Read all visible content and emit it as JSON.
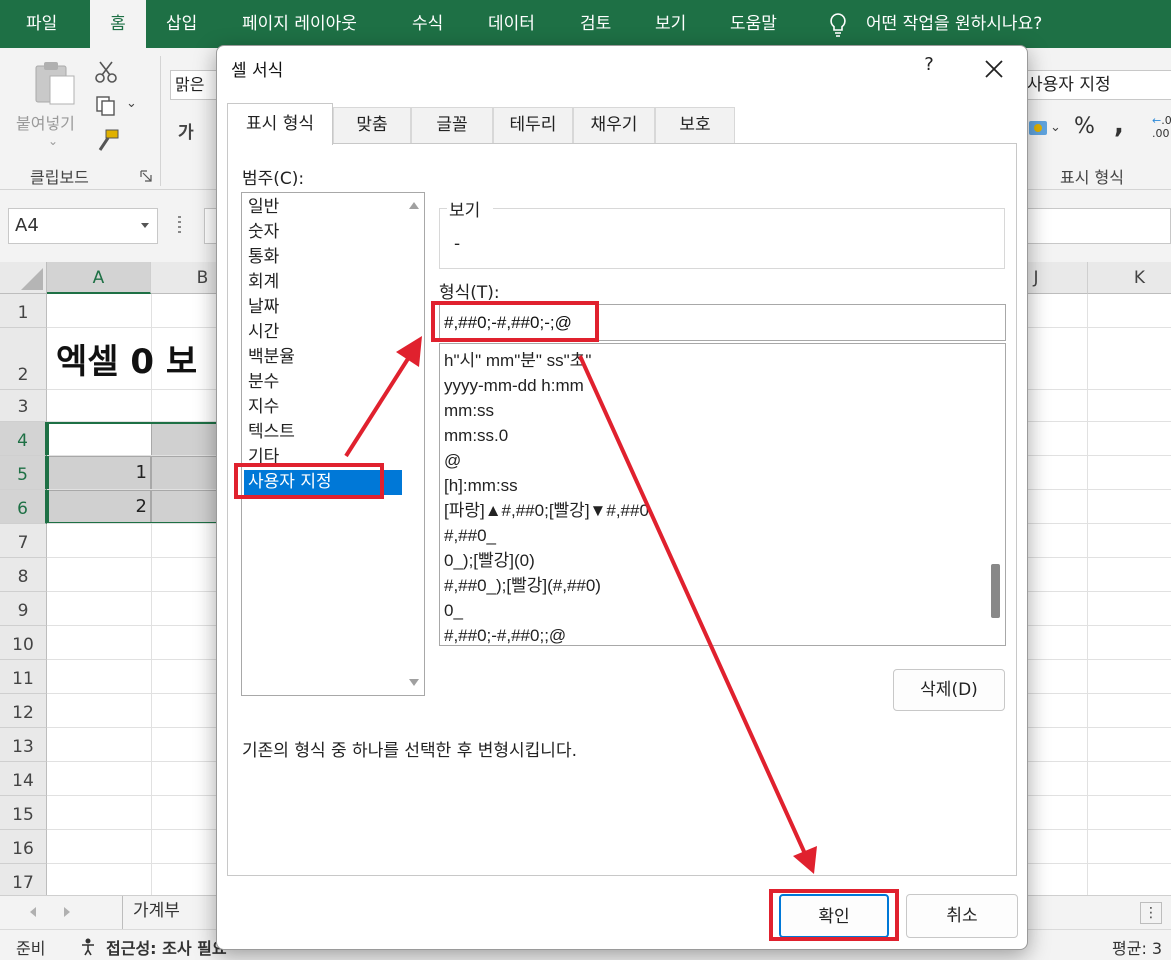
{
  "ribbon_tabs": [
    "파일",
    "홈",
    "삽입",
    "페이지 레이아웃",
    "수식",
    "데이터",
    "검토",
    "보기",
    "도움말"
  ],
  "tell_me": "어떤 작업을 원하시나요?",
  "ribbon": {
    "paste_label": "붙여넣기",
    "paste_chevron": "⌄",
    "clipboard_group": "클립보드",
    "font_name": "맑은",
    "font_bold_partial": "가",
    "number_format_value": "사용자 지정",
    "percent": "%",
    "comma": ",",
    "number_group": "표시 형식",
    "dec_top": ".0",
    "dec_bottom": ".00"
  },
  "name_box": "A4",
  "columns": [
    "A",
    "B",
    "J",
    "K"
  ],
  "rows": [
    "1",
    "2",
    "3",
    "4",
    "5",
    "6",
    "7",
    "8",
    "9",
    "10",
    "11",
    "12",
    "13",
    "14",
    "15",
    "16",
    "17"
  ],
  "sheet": {
    "title_text": "엑셀 0 보",
    "a5": "1",
    "a6": "2",
    "tab_name": "가계부",
    "tab_extra": "+"
  },
  "status": {
    "ready": "준비",
    "accessibility": "접근성: 조사 필요",
    "average": "평균: 3"
  },
  "dialog": {
    "title": "셀 서식",
    "help": "?",
    "tabs": [
      "표시 형식",
      "맞춤",
      "글꼴",
      "테두리",
      "채우기",
      "보호"
    ],
    "category_label": "범주(C):",
    "categories": [
      "일반",
      "숫자",
      "통화",
      "회계",
      "날짜",
      "시간",
      "백분율",
      "분수",
      "지수",
      "텍스트",
      "기타",
      "사용자 지정"
    ],
    "sample_label": "보기",
    "sample_value": "-",
    "type_label": "형식(T):",
    "type_value": "#,##0;-#,##0;-;@",
    "formats": [
      "h\"시\" mm\"분\" ss\"초\"",
      "yyyy-mm-dd h:mm",
      "mm:ss",
      "mm:ss.0",
      "@",
      "[h]:mm:ss",
      "[파랑]▲#,##0;[빨강]▼#,##0",
      "#,##0_",
      "0_);[빨강](0)",
      "#,##0_);[빨강](#,##0)",
      "0_",
      "#,##0;-#,##0;;@"
    ],
    "delete_button": "삭제(D)",
    "description": "기존의 형식 중 하나를 선택한 후 변형시킵니다.",
    "ok_button": "확인",
    "cancel_button": "취소"
  },
  "colors": {
    "excel_green": "#1e7045",
    "selection_blue": "#0078d7",
    "annotation_red": "#e0212e"
  }
}
